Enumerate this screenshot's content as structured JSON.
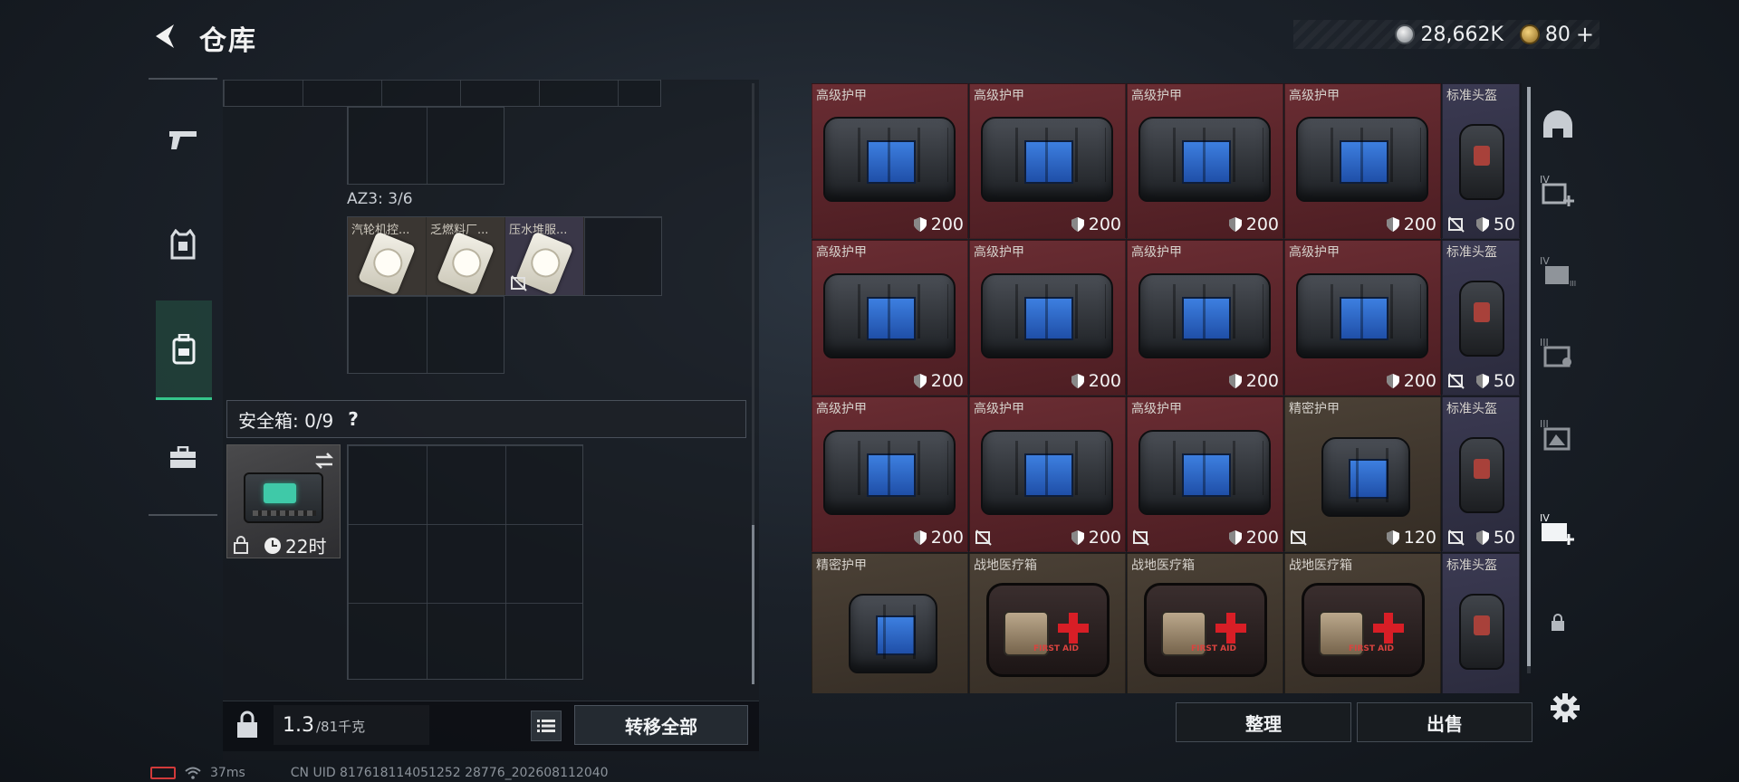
{
  "header": {
    "title": "仓库",
    "back_label": "back"
  },
  "currency": {
    "silver": {
      "amount": "28,662K",
      "icon": "silver-coin-icon",
      "color": "#c9cdd2"
    },
    "gold": {
      "amount": "80",
      "icon": "gold-coin-icon",
      "color": "#d9b25a",
      "plus": "+"
    }
  },
  "left_rail": {
    "items": [
      {
        "name": "weapons",
        "icon": "pistol-icon"
      },
      {
        "name": "equipment",
        "icon": "vest-icon"
      },
      {
        "name": "backpack",
        "icon": "backpack-icon",
        "active": true
      },
      {
        "name": "case",
        "icon": "briefcase-icon"
      }
    ]
  },
  "container": {
    "az3_label": "AZ3: 3/6",
    "az3_items": [
      {
        "label": "汽轮机控...",
        "icon": "pill-pack-icon"
      },
      {
        "label": "乏燃料厂...",
        "icon": "pill-pack-icon"
      },
      {
        "label": "压水堆服...",
        "icon": "pill-pack-icon",
        "broken": true
      }
    ]
  },
  "safe_box": {
    "label": "安全箱: 0/9",
    "help": "?",
    "timer": "22时"
  },
  "bottom": {
    "weight_value": "1.3",
    "weight_unit": "/81千克",
    "transfer_all": "转移全部"
  },
  "stash": {
    "rows": [
      {
        "cells": [
          {
            "label": "高级护甲",
            "kind": "armor-high",
            "value": "200"
          },
          {
            "label": "高级护甲",
            "kind": "armor-high",
            "value": "200"
          },
          {
            "label": "高级护甲",
            "kind": "armor-high",
            "value": "200"
          },
          {
            "label": "高级护甲",
            "kind": "armor-high",
            "value": "200"
          },
          {
            "label": "标准头盔",
            "kind": "helmet",
            "value": "50",
            "broken": true
          }
        ]
      },
      {
        "cells": [
          {
            "label": "高级护甲",
            "kind": "armor-high",
            "value": "200"
          },
          {
            "label": "高级护甲",
            "kind": "armor-high",
            "value": "200"
          },
          {
            "label": "高级护甲",
            "kind": "armor-high",
            "value": "200"
          },
          {
            "label": "高级护甲",
            "kind": "armor-high",
            "value": "200"
          },
          {
            "label": "标准头盔",
            "kind": "helmet",
            "value": "50",
            "broken": true
          }
        ]
      },
      {
        "cells": [
          {
            "label": "高级护甲",
            "kind": "armor-high",
            "value": "200"
          },
          {
            "label": "高级护甲",
            "kind": "armor-high",
            "value": "200",
            "broken": true
          },
          {
            "label": "高级护甲",
            "kind": "armor-high",
            "value": "200",
            "broken": true
          },
          {
            "label": "精密护甲",
            "kind": "armor-prec",
            "value": "120",
            "broken": true
          },
          {
            "label": "标准头盔",
            "kind": "helmet",
            "value": "50",
            "broken": true
          }
        ]
      },
      {
        "cells": [
          {
            "label": "精密护甲",
            "kind": "armor-prec",
            "value": ""
          },
          {
            "label": "战地医疗箱",
            "kind": "medkit",
            "value": "",
            "text": "FIRST AID"
          },
          {
            "label": "战地医疗箱",
            "kind": "medkit",
            "value": "",
            "text": "FIRST AID"
          },
          {
            "label": "战地医疗箱",
            "kind": "medkit",
            "value": "",
            "text": "FIRST AID"
          },
          {
            "label": "标准头盔",
            "kind": "helmet",
            "value": ""
          }
        ]
      }
    ]
  },
  "right_rail": {
    "items": [
      {
        "name": "helmet-filter",
        "icon": "helmet-filter-icon"
      },
      {
        "name": "armor-iv-add",
        "icon": "armor-iv-plus-icon",
        "badge": "IV"
      },
      {
        "name": "iv-filter",
        "icon": "armor-iv-filter-icon",
        "badge": "IV"
      },
      {
        "name": "iii-filter",
        "icon": "armor-iii-filter-icon",
        "badge": "III"
      },
      {
        "name": "iii-filter-2",
        "icon": "armor-iii-filter-2-icon",
        "badge": "III"
      },
      {
        "name": "iv-add-active",
        "icon": "armor-iv-plus-icon",
        "badge": "IV"
      },
      {
        "name": "lock",
        "icon": "lock-icon"
      }
    ]
  },
  "actions": {
    "sort": "整理",
    "sell": "出售"
  },
  "status": {
    "ping": "37ms",
    "uid": "CN UID 817618114051252 28776_202608112040"
  },
  "colors": {
    "armor_high_bg": "#5a242a",
    "armor_prec_bg": "#3f362c",
    "helmet_bg": "#33334a",
    "accent_green": "#35c58b"
  }
}
